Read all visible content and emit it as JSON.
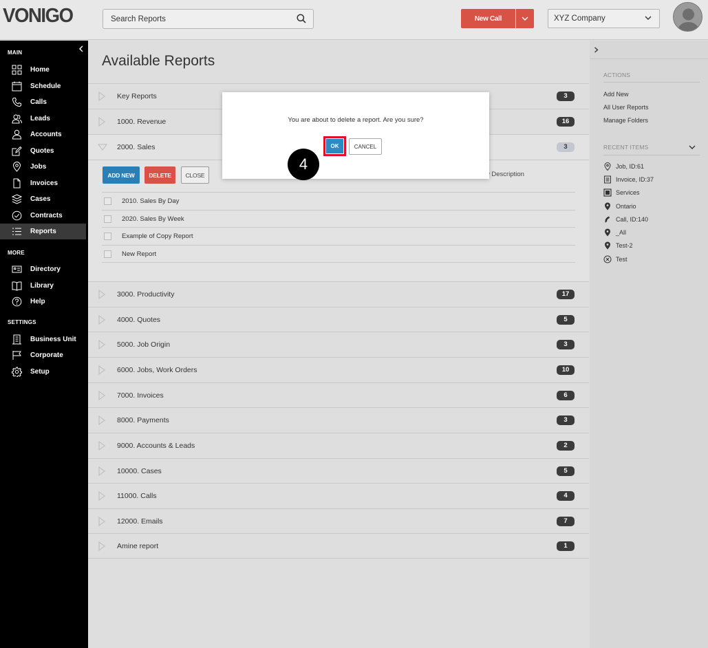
{
  "header": {
    "logo_text": "VONIGO",
    "search_placeholder": "Search Reports",
    "new_call_label": "New Call",
    "company_selected": "XYZ Company"
  },
  "sidebar": {
    "sections": [
      {
        "label": "MAIN",
        "items": [
          {
            "label": "Home",
            "icon": "home-icon"
          },
          {
            "label": "Schedule",
            "icon": "calendar-icon"
          },
          {
            "label": "Calls",
            "icon": "phone-icon"
          },
          {
            "label": "Leads",
            "icon": "leads-icon"
          },
          {
            "label": "Accounts",
            "icon": "user-icon"
          },
          {
            "label": "Quotes",
            "icon": "edit-icon"
          },
          {
            "label": "Jobs",
            "icon": "location-pin-icon"
          },
          {
            "label": "Invoices",
            "icon": "document-icon"
          },
          {
            "label": "Cases",
            "icon": "layers-icon"
          },
          {
            "label": "Contracts",
            "icon": "check-circle-icon"
          },
          {
            "label": "Reports",
            "icon": "list-icon",
            "active": true
          }
        ]
      },
      {
        "label": "MORE",
        "items": [
          {
            "label": "Directory",
            "icon": "id-card-icon"
          },
          {
            "label": "Library",
            "icon": "book-icon"
          },
          {
            "label": "Help",
            "icon": "help-icon"
          }
        ]
      },
      {
        "label": "SETTINGS",
        "items": [
          {
            "label": "Business Unit",
            "icon": "building-icon"
          },
          {
            "label": "Corporate",
            "icon": "flag-icon"
          },
          {
            "label": "Setup",
            "icon": "gear-icon"
          }
        ]
      }
    ]
  },
  "main": {
    "title": "Available Reports",
    "folders_top": [
      {
        "name": "Key Reports",
        "count": "3"
      },
      {
        "name": "1000. Revenue",
        "count": "16"
      },
      {
        "name": "2000. Sales",
        "count": "3"
      }
    ],
    "expanded": {
      "add_new_label": "ADD NEW",
      "delete_label": "DELETE",
      "close_label": "CLOSE",
      "show_description_label": "Show Description",
      "reports": [
        "2010. Sales By Day",
        "2020. Sales By Week",
        "Example of Copy Report",
        "New Report"
      ]
    },
    "folders_bottom": [
      {
        "name": "3000. Productivity",
        "count": "17"
      },
      {
        "name": "4000. Quotes",
        "count": "5"
      },
      {
        "name": "5000. Job Origin",
        "count": "3"
      },
      {
        "name": "6000. Jobs, Work Orders",
        "count": "10"
      },
      {
        "name": "7000. Invoices",
        "count": "6"
      },
      {
        "name": "8000. Payments",
        "count": "3"
      },
      {
        "name": "9000. Accounts & Leads",
        "count": "2"
      },
      {
        "name": "10000. Cases",
        "count": "5"
      },
      {
        "name": "11000. Calls",
        "count": "4"
      },
      {
        "name": "12000. Emails",
        "count": "7"
      },
      {
        "name": "Amine report",
        "count": "1"
      }
    ]
  },
  "right_panel": {
    "actions_heading": "ACTIONS",
    "actions": [
      "Add New",
      "All User Reports",
      "Manage Folders"
    ],
    "recent_heading": "RECENT ITEMS",
    "recent": [
      {
        "label": "Job, ID:61",
        "icon": "location-pin-icon"
      },
      {
        "label": "Invoice, ID:37",
        "icon": "document-icon"
      },
      {
        "label": "Services",
        "icon": "list-box-icon"
      },
      {
        "label": "Ontario",
        "icon": "location-pin-icon"
      },
      {
        "label": "Call, ID:140",
        "icon": "phone-icon"
      },
      {
        "label": "_All",
        "icon": "location-pin-icon"
      },
      {
        "label": "Test-2",
        "icon": "location-pin-icon"
      },
      {
        "label": "Test",
        "icon": "x-circle-icon"
      }
    ]
  },
  "dialog": {
    "message": "You are about to delete a report. Are you sure?",
    "ok_label": "OK",
    "cancel_label": "CANCEL",
    "step_number": "4"
  },
  "colors": {
    "accent_blue": "#2a7fb6",
    "danger_red": "#d85245",
    "highlight_red": "#e0102a",
    "sidebar_bg": "#000000"
  }
}
